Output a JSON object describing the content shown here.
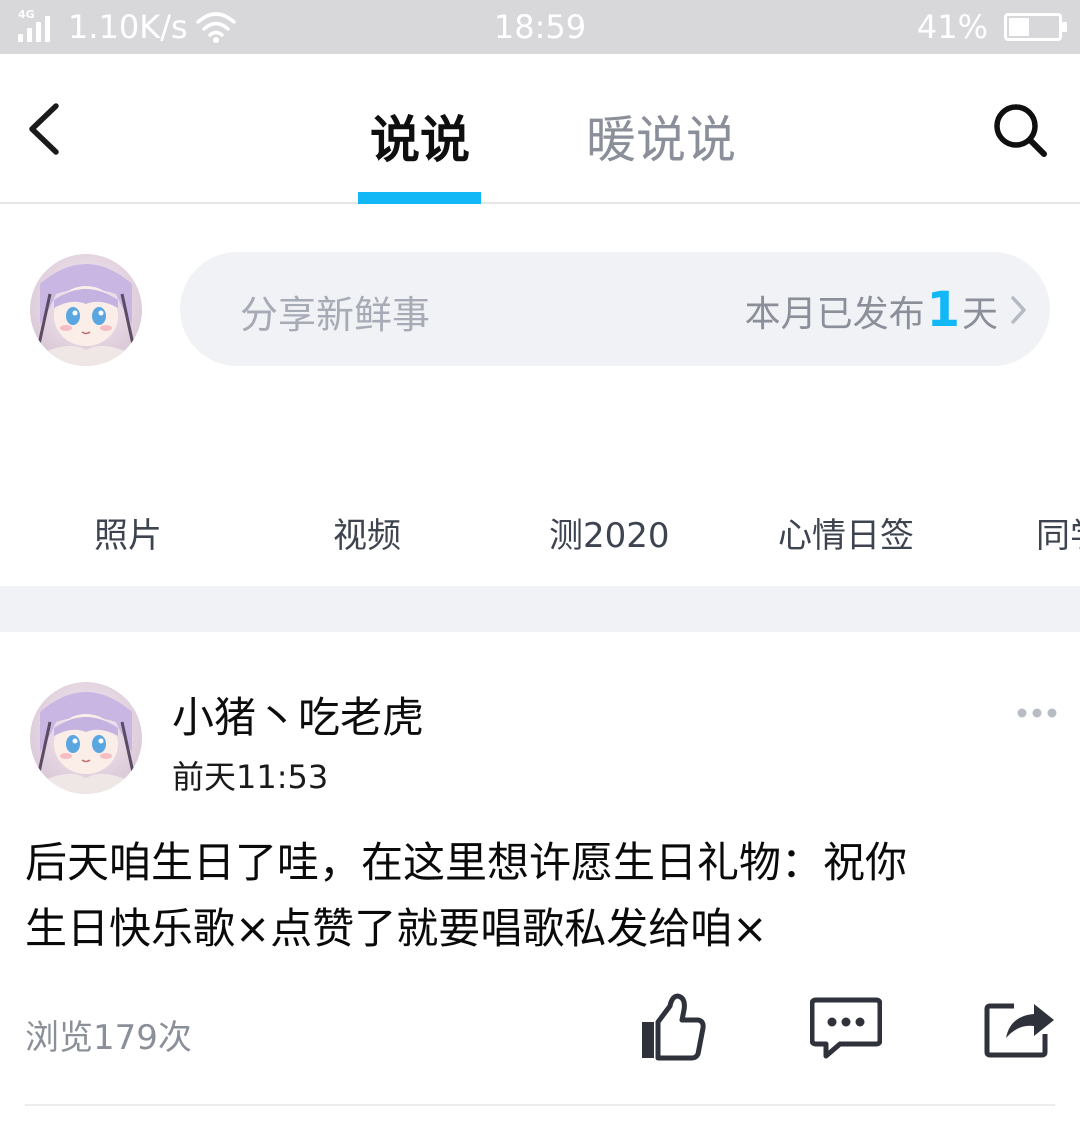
{
  "status_bar": {
    "network_type": "4G",
    "net_speed": "1.10K/s",
    "time": "18:59",
    "battery_percent": "41%",
    "battery_level": 0.41,
    "icons": [
      "signal-icon",
      "wifi-icon",
      "battery-icon"
    ]
  },
  "nav": {
    "back_icon": "chevron-left-icon",
    "tabs": [
      {
        "label": "说说",
        "active": true
      },
      {
        "label": "暖说说",
        "active": false
      }
    ],
    "search_icon": "search-icon",
    "accent_color": "#12b7f5"
  },
  "composer": {
    "placeholder": "分享新鲜事",
    "stats_prefix": "本月已发布",
    "stats_count": "1",
    "stats_suffix": "天",
    "chevron_icon": "chevron-right-icon"
  },
  "quick_tabs": [
    "照片",
    "视频",
    "测2020",
    "心情日签",
    "同学"
  ],
  "post": {
    "author": "小猪丶吃老虎",
    "time": "前天11:53",
    "more_icon": "more-icon",
    "text_line1": "后天咱生日了哇，在这里想许愿生日礼物：祝你",
    "text_line2": "生日快乐歌×点赞了就要唱歌私发给咱×",
    "views": "浏览179次",
    "actions": [
      "like-icon",
      "comment-icon",
      "share-icon"
    ]
  }
}
